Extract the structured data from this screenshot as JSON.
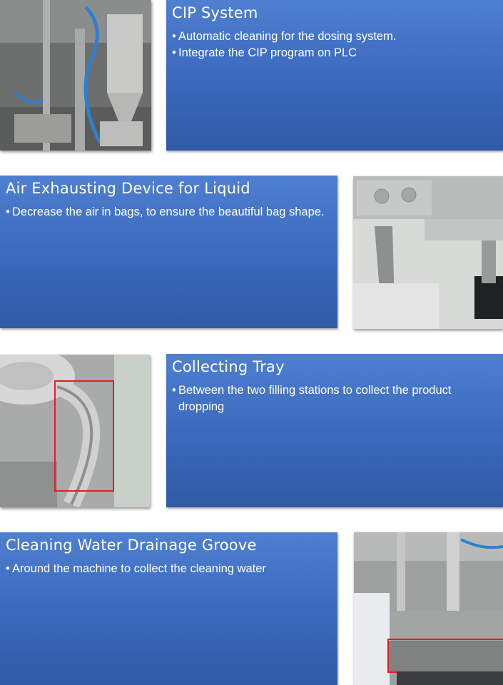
{
  "sections": [
    {
      "title": "CIP System",
      "bullets": [
        "Automatic cleaning for the dosing system.",
        "Integrate the CIP program on PLC"
      ],
      "image_subject": "stainless-steel-dosing-hopper-with-blue-hoses"
    },
    {
      "title": "Air Exhausting Device for Liquid",
      "bullets": [
        "Decrease the air in bags, to ensure the beautiful bag shape."
      ],
      "image_subject": "stainless-steel-exhaust-clamp-arm"
    },
    {
      "title": "Collecting Tray",
      "bullets": [
        "Between the two filling stations to collect the product dropping"
      ],
      "image_subject": "curved-collecting-tray-highlighted-red"
    },
    {
      "title": "Cleaning Water Drainage Groove",
      "bullets": [
        "Around the machine to collect the cleaning water"
      ],
      "image_subject": "machine-base-drainage-groove-highlighted-red"
    }
  ],
  "bullet_glyph": "•",
  "colors": {
    "panel_top": "#4f7fd0",
    "panel_bottom": "#2f5aa5",
    "highlight": "#e02020"
  }
}
